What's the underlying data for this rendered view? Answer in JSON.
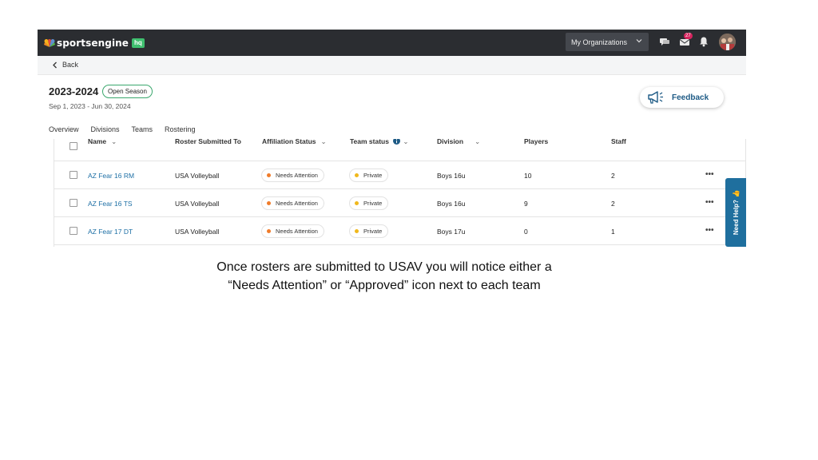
{
  "topbar": {
    "brand": "sportsengine",
    "brand_badge": "hq",
    "org_menu_label": "My Organizations",
    "mail_count": "27",
    "icons": [
      "chat-icon",
      "mail-icon",
      "bell-icon",
      "avatar"
    ]
  },
  "nav": {
    "back_label": "Back"
  },
  "season": {
    "title": "2023-2024",
    "badge": "Open Season",
    "dates": "Sep 1, 2023 - Jun 30, 2024"
  },
  "feedback": {
    "label": "Feedback"
  },
  "tabs": [
    {
      "label": "Overview",
      "active": false
    },
    {
      "label": "Divisions",
      "active": false
    },
    {
      "label": "Teams",
      "active": true
    },
    {
      "label": "Rostering",
      "active": false
    }
  ],
  "table": {
    "columns": [
      "Name",
      "Roster Submitted To",
      "Affiliation Status",
      "Team status",
      "Division",
      "Players",
      "Staff"
    ],
    "rows": [
      {
        "name": "AZ Fear 16 RM",
        "submitted_to": "USA Volleyball",
        "affiliation": "Needs Attention",
        "team_status": "Private",
        "division": "Boys 16u",
        "players": "10",
        "staff": "2"
      },
      {
        "name": "AZ Fear 16 TS",
        "submitted_to": "USA Volleyball",
        "affiliation": "Needs Attention",
        "team_status": "Private",
        "division": "Boys 16u",
        "players": "9",
        "staff": "2"
      },
      {
        "name": "AZ Fear 17 DT",
        "submitted_to": "USA Volleyball",
        "affiliation": "Needs Attention",
        "team_status": "Private",
        "division": "Boys 17u",
        "players": "0",
        "staff": "1"
      }
    ],
    "more_label": "•••"
  },
  "help_tab": {
    "label": "Need Help? 👍"
  },
  "caption": {
    "line1": "Once rosters are submitted to USAV you will notice either a",
    "line2": "“Needs Attention” or “Approved” icon next to each team"
  },
  "colors": {
    "topbar": "#2b2d31",
    "accent_blue": "#1d5a85",
    "needs_attention_dot": "#f07c2b",
    "private_dot": "#f0b81c",
    "open_season_border": "#3aa76d",
    "help_tab": "#1f6f9e"
  }
}
